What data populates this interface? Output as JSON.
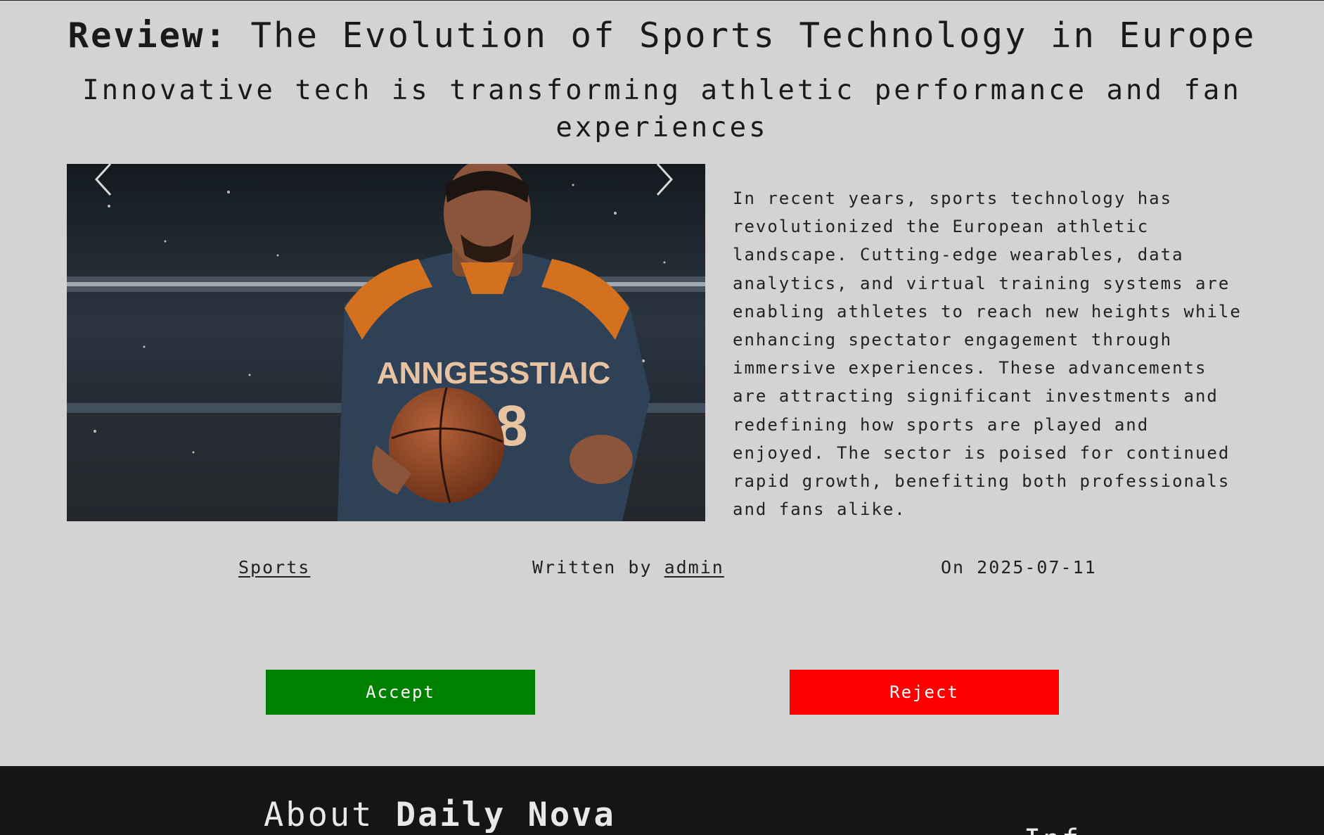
{
  "article": {
    "title_prefix": "Review:",
    "title": "The Evolution of Sports Technology in Europe",
    "subtitle": "Innovative tech is transforming athletic performance and fan experiences",
    "body": "In recent years, sports technology has revolutionized the European athletic landscape. Cutting-edge wearables, data analytics, and virtual training systems are enabling athletes to reach new heights while enhancing spectator engagement through immersive experiences. These advancements are attracting significant investments and redefining how sports are played and enjoyed. The sector is poised for continued rapid growth, benefiting both professionals and fans alike.",
    "image_jersey_text": "ANNGESSTIAIC",
    "image_jersey_number": "18"
  },
  "meta": {
    "category": "Sports",
    "written_by_label": "Written by",
    "author": "admin",
    "date_label": "On",
    "date": "2025-07-11"
  },
  "actions": {
    "accept_label": "Accept",
    "reject_label": "Reject"
  },
  "footer": {
    "about_label": "About",
    "brand": "Daily Nova",
    "info_heading": "Inf"
  },
  "icons": {
    "carousel_prev": "chevron-left-icon",
    "carousel_next": "chevron-right-icon"
  },
  "colors": {
    "background": "#d3d3d3",
    "accept": "#008000",
    "reject": "#ff0000",
    "footer": "#151515"
  }
}
